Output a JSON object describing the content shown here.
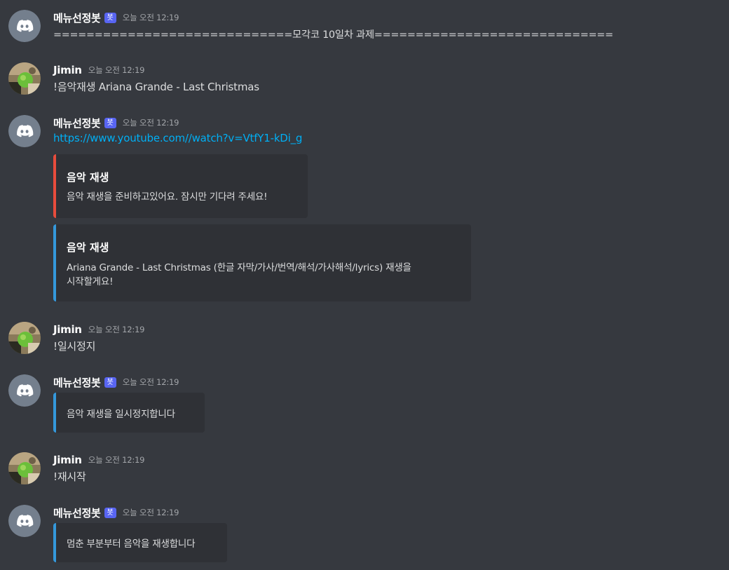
{
  "colors": {
    "background": "#36393f",
    "embed_background": "#2f3136",
    "bot_tag": "#5865f2",
    "link": "#00aff4",
    "embed_accent_red": "#e74c3c",
    "embed_accent_blue": "#3498db",
    "discord_avatar": "#747f8d"
  },
  "users": {
    "bot": {
      "name": "메뉴선정봇",
      "tag": "봇",
      "avatar_icon": "discord-logo-icon"
    },
    "human": {
      "name": "Jimin",
      "avatar_icon": "user-photo-avatar"
    }
  },
  "messages": [
    {
      "author": "메뉴선정봇",
      "bot_tag": "봇",
      "time": "오늘 오전 12:19",
      "text": "=============================모각코 10일차 과제============================="
    },
    {
      "author": "Jimin",
      "time": "오늘 오전 12:19",
      "text": "!음악재생 Ariana Grande - Last Christmas"
    },
    {
      "author": "메뉴선정봇",
      "bot_tag": "봇",
      "time": "오늘 오전 12:19",
      "link": "https://www.youtube.com//watch?v=VtfY1-kDi_g",
      "embeds": [
        {
          "title": "음악 재생",
          "description": "음악 재생을 준비하고있어요. 잠시만 기다려 주세요!",
          "accent": "red"
        },
        {
          "title": "음악 재생",
          "description_line1": "Ariana Grande - Last Christmas (한글 자막/가사/번역/해석/가사해석/lyrics) 재생을",
          "description_line2": "시작할게요!",
          "accent": "blue"
        }
      ]
    },
    {
      "author": "Jimin",
      "time": "오늘 오전 12:19",
      "text": "!일시정지"
    },
    {
      "author": "메뉴선정봇",
      "bot_tag": "봇",
      "time": "오늘 오전 12:19",
      "embeds": [
        {
          "description": "음악 재생을 일시정지합니다",
          "accent": "blue"
        }
      ]
    },
    {
      "author": "Jimin",
      "time": "오늘 오전 12:19",
      "text": "!재시작"
    },
    {
      "author": "메뉴선정봇",
      "bot_tag": "봇",
      "time": "오늘 오전 12:19",
      "embeds": [
        {
          "description": "멈춘 부분부터 음악을 재생합니다",
          "accent": "blue"
        }
      ]
    }
  ]
}
